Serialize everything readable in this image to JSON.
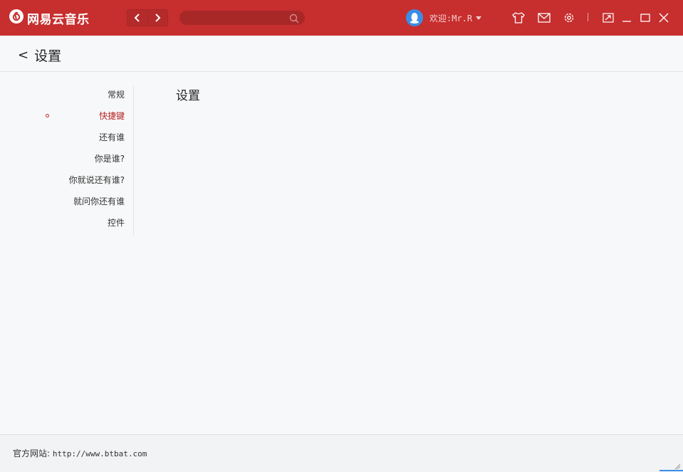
{
  "app": {
    "name": "网易云音乐",
    "brand_color": "#c72e2e"
  },
  "titlebar": {
    "search_placeholder": "",
    "welcome": "欢迎:Mr.R",
    "icons": [
      "skin-icon",
      "mail-icon",
      "gear-icon",
      "mini-mode-icon",
      "minimize-icon",
      "maximize-icon",
      "close-icon"
    ]
  },
  "header": {
    "back_arrow": "<",
    "title": "设置"
  },
  "sidebar": {
    "items": [
      {
        "label": "常规",
        "active": false
      },
      {
        "label": "快捷键",
        "active": true
      },
      {
        "label": "还有谁",
        "active": false
      },
      {
        "label": "你是谁?",
        "active": false
      },
      {
        "label": "你就说还有谁?",
        "active": false
      },
      {
        "label": "就问你还有谁",
        "active": false
      },
      {
        "label": "控件",
        "active": false
      }
    ]
  },
  "content": {
    "title": "设置"
  },
  "footer": {
    "label": "官方网站:",
    "url": "http://www.btbat.com"
  }
}
